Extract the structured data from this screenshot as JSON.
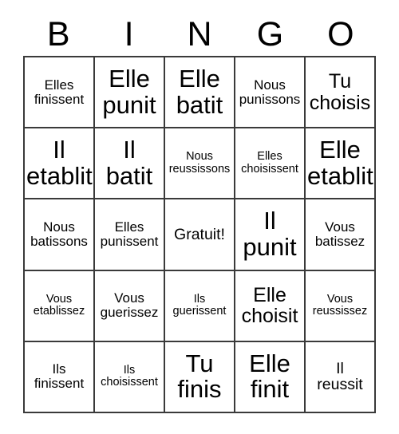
{
  "header": {
    "letters": [
      "B",
      "I",
      "N",
      "G",
      "O"
    ]
  },
  "grid": {
    "columns": 5,
    "rows": 5,
    "border_color": "#3a3a3a",
    "background_color": "#ffffff",
    "text_color": "#000000",
    "free_space_label": "Gratuit!",
    "cells": [
      {
        "text": "Elles\nfinissent",
        "size": "s"
      },
      {
        "text": "Elle\npunit",
        "size": "xl"
      },
      {
        "text": "Elle\nbatit",
        "size": "xl"
      },
      {
        "text": "Nous\npunissons",
        "size": "s"
      },
      {
        "text": "Tu\nchoisis",
        "size": "l"
      },
      {
        "text": "Il\netablit",
        "size": "xl"
      },
      {
        "text": "Il\nbatit",
        "size": "xl"
      },
      {
        "text": "Nous\nreussissons",
        "size": "xs"
      },
      {
        "text": "Elles\nchoisissent",
        "size": "xs"
      },
      {
        "text": "Elle\netablit",
        "size": "xl"
      },
      {
        "text": "Nous\nbatissons",
        "size": "s"
      },
      {
        "text": "Elles\npunissent",
        "size": "s"
      },
      {
        "text": "Gratuit!",
        "size": "m"
      },
      {
        "text": "Il\npunit",
        "size": "xl"
      },
      {
        "text": "Vous\nbatissez",
        "size": "s"
      },
      {
        "text": "Vous\netablissez",
        "size": "xs"
      },
      {
        "text": "Vous\nguerissez",
        "size": "s"
      },
      {
        "text": "Ils\nguerissent",
        "size": "xs"
      },
      {
        "text": "Elle\nchoisit",
        "size": "l"
      },
      {
        "text": "Vous\nreussissez",
        "size": "xs"
      },
      {
        "text": "Ils\nfinissent",
        "size": "s"
      },
      {
        "text": "Ils\nchoisissent",
        "size": "xs"
      },
      {
        "text": "Tu\nfinis",
        "size": "xl"
      },
      {
        "text": "Elle\nfinit",
        "size": "xl"
      },
      {
        "text": "Il\nreussit",
        "size": "m"
      }
    ]
  }
}
